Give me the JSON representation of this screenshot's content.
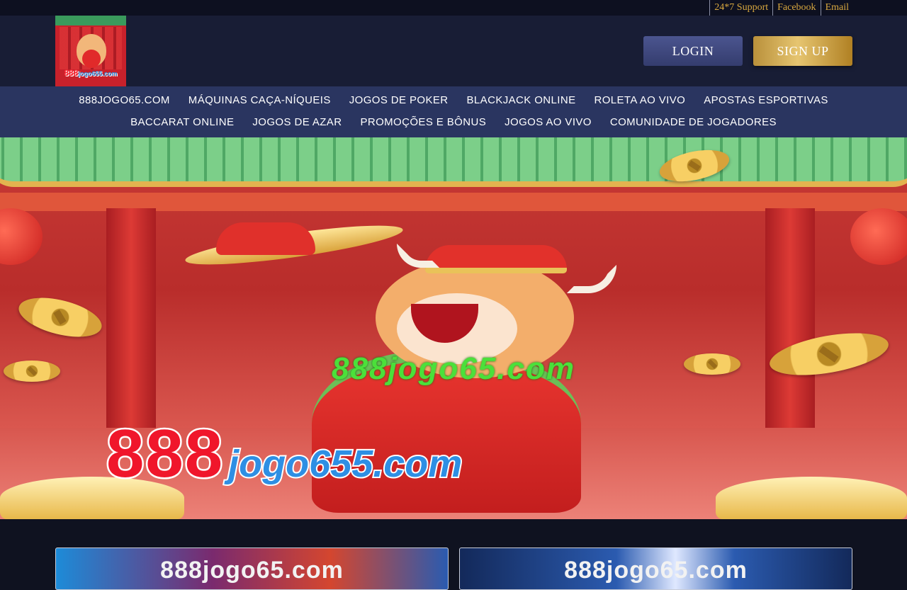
{
  "topbar": {
    "links": [
      "24*7 Support",
      "Facebook",
      "Email"
    ]
  },
  "header": {
    "logo_text": "888",
    "logo_domain": "jogo655.com",
    "login_label": "LOGIN",
    "signup_label": "SIGN UP"
  },
  "nav": {
    "row1": [
      "888JOGO65.COM",
      "MÁQUINAS CAÇA-NÍQUEIS",
      "JOGOS DE POKER",
      "BLACKJACK ONLINE",
      "ROLETA AO VIVO",
      "APOSTAS ESPORTIVAS"
    ],
    "row2": [
      "BACCARAT ONLINE",
      "JOGOS DE AZAR",
      "PROMOÇÕES E BÔNUS",
      "JOGOS AO VIVO",
      "COMUNIDADE DE JOGADORES"
    ]
  },
  "hero": {
    "url_green": "888jogo65.com",
    "brand_number": "888",
    "brand_domain": "jogo655.com"
  },
  "cards": [
    {
      "text": "888jogo65.com"
    },
    {
      "text": "888jogo65.com"
    }
  ],
  "colors": {
    "topbar_link": "#d9a83f",
    "header_bg": "#181d35",
    "nav_bg": "#2a3560",
    "login_bg": "#3f4880",
    "signup_gold": "#d4af55"
  }
}
